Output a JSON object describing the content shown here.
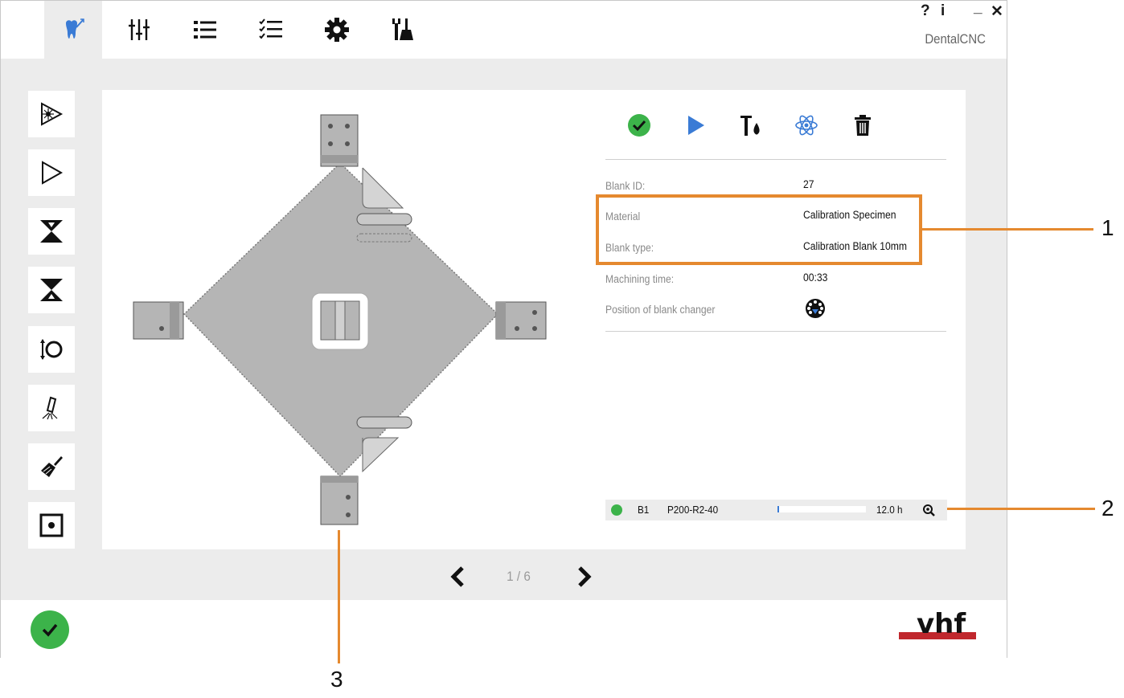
{
  "app": {
    "name": "DentalCNC"
  },
  "window_controls": {
    "help": "?",
    "info": "i",
    "minimize": "_",
    "close": "✕"
  },
  "topbar": {
    "tabs": [
      {
        "icon": "tooth-milling-icon",
        "active": true
      },
      {
        "icon": "mixer-sliders-icon",
        "active": false
      },
      {
        "icon": "list-icon",
        "active": false
      },
      {
        "icon": "checklist-icon",
        "active": false
      },
      {
        "icon": "gear-icon",
        "active": false
      },
      {
        "icon": "tools-brush-icon",
        "active": false
      }
    ]
  },
  "sidebar": {
    "items": [
      {
        "icon": "laser-play-icon"
      },
      {
        "icon": "play-outline-icon"
      },
      {
        "icon": "blank-down-icon"
      },
      {
        "icon": "blank-up-icon"
      },
      {
        "icon": "rotate-spindle-icon"
      },
      {
        "icon": "spray-nozzle-icon"
      },
      {
        "icon": "cleaning-brush-icon"
      },
      {
        "icon": "stop-square-icon"
      }
    ]
  },
  "actions": [
    {
      "icon": "check-circle-icon",
      "color": "#3cb34a"
    },
    {
      "icon": "play-icon",
      "color": "#3a7bd5"
    },
    {
      "icon": "tool-liquid-icon",
      "color": "#111111"
    },
    {
      "icon": "atom-icon",
      "color": "#3a7bd5"
    },
    {
      "icon": "trash-icon",
      "color": "#111111"
    }
  ],
  "details": {
    "blank_id_label": "Blank ID:",
    "blank_id_value": "27",
    "material_label": "Material",
    "material_value": "Calibration Specimen",
    "blank_type_label": "Blank type:",
    "blank_type_value": "Calibration Blank 10mm",
    "machining_time_label": "Machining time:",
    "machining_time_value": "00:33",
    "position_label": "Position of blank changer",
    "position_icon": "blank-changer-wheel-icon"
  },
  "tool_row": {
    "status_color": "#3cb34a",
    "slot": "B1",
    "tool": "P200-R2-40",
    "life_fraction": 0.01,
    "life": "12.0 h",
    "icon": "tool-search-icon"
  },
  "pagination": {
    "text": "1 / 6"
  },
  "footer": {
    "confirm_icon": "check-circle-icon",
    "logo": "vhf"
  },
  "callouts": [
    "1",
    "2",
    "3"
  ],
  "colors": {
    "accent": "#e5892f",
    "green": "#3cb34a",
    "blue": "#3a7bd5",
    "logo_red": "#c0272d"
  }
}
